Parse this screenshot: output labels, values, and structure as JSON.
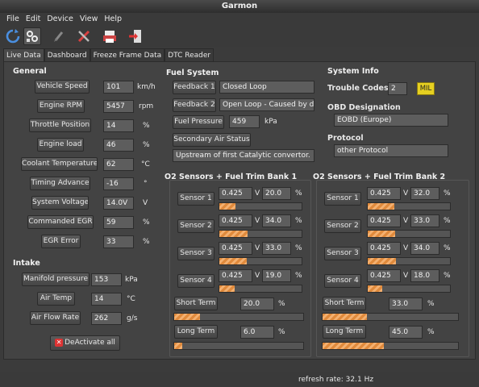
{
  "window": {
    "title": "Garmon"
  },
  "menu": [
    "File",
    "Edit",
    "Device",
    "View",
    "Help"
  ],
  "toolbar": {
    "icons": [
      "refresh-icon",
      "settings-icon",
      "clear-icon",
      "tools-icon",
      "print-icon",
      "exit-icon"
    ]
  },
  "tabs": [
    "Live Data",
    "Dashboard",
    "Freeze Frame Data",
    "DTC Reader"
  ],
  "general": {
    "title": "General",
    "rows": [
      {
        "label": "Vehicle Speed",
        "value": "101",
        "unit": "km/h"
      },
      {
        "label": "Engine RPM",
        "value": "5457",
        "unit": "rpm"
      },
      {
        "label": "Throttle Position",
        "value": "14",
        "unit": "%"
      },
      {
        "label": "Engine load",
        "value": "46",
        "unit": "%"
      },
      {
        "label": "Coolant Temperature",
        "value": "62",
        "unit": "°C"
      },
      {
        "label": "Timing Advance",
        "value": "-16",
        "unit": "°"
      },
      {
        "label": "System Voltage",
        "value": "14.0V",
        "unit": "V"
      },
      {
        "label": "Commanded EGR",
        "value": "59",
        "unit": "%"
      },
      {
        "label": "EGR Error",
        "value": "33",
        "unit": "%"
      }
    ]
  },
  "intake": {
    "title": "Intake",
    "rows": [
      {
        "label": "Manifold pressure",
        "value": "153",
        "unit": "kPa"
      },
      {
        "label": "Air Temp",
        "value": "14",
        "unit": "°C"
      },
      {
        "label": "Air Flow Rate",
        "value": "262",
        "unit": "g/s"
      }
    ]
  },
  "deactivate_label": "DeActivate all",
  "fuel": {
    "title": "Fuel System",
    "feedback1_label": "Feedback 1",
    "feedback1_value": "Closed Loop",
    "feedback2_label": "Feedback 2",
    "feedback2_value": "Open Loop - Caused by dri",
    "pressure_label": "Fuel Pressure",
    "pressure_value": "459",
    "pressure_unit": "kPa",
    "secondary_label": "Secondary Air Status",
    "secondary_value": "Upstream of first Catalytic convertor."
  },
  "system": {
    "title": "System Info",
    "trouble_label": "Trouble Codes",
    "trouble_value": "2",
    "mil_label": "MIL",
    "obd_label": "OBD Designation",
    "obd_value": "EOBD (Europe)",
    "protocol_label": "Protocol",
    "protocol_value": "other Protocol"
  },
  "bank1": {
    "title": "O2 Sensors + Fuel Trim Bank 1",
    "sensors": [
      {
        "label": "Sensor 1",
        "voltage": "0.425",
        "trim": "20.0",
        "level": 0.2
      },
      {
        "label": "Sensor 2",
        "voltage": "0.425",
        "trim": "34.0",
        "level": 0.34
      },
      {
        "label": "Sensor 3",
        "voltage": "0.425",
        "trim": "33.0",
        "level": 0.33
      },
      {
        "label": "Sensor 4",
        "voltage": "0.425",
        "trim": "19.0",
        "level": 0.19
      }
    ],
    "short_label": "Short Term",
    "short_value": "20.0",
    "short_level": 0.2,
    "long_label": "Long Term",
    "long_value": "6.0",
    "long_level": 0.06
  },
  "bank2": {
    "title": "O2 Sensors + Fuel Trim Bank 2",
    "sensors": [
      {
        "label": "Sensor 1",
        "voltage": "0.425",
        "trim": "32.0",
        "level": 0.32
      },
      {
        "label": "Sensor 2",
        "voltage": "0.425",
        "trim": "33.0",
        "level": 0.33
      },
      {
        "label": "Sensor 3",
        "voltage": "0.425",
        "trim": "34.0",
        "level": 0.34
      },
      {
        "label": "Sensor 4",
        "voltage": "0.425",
        "trim": "18.0",
        "level": 0.18
      }
    ],
    "short_label": "Short Term",
    "short_value": "33.0",
    "short_level": 0.33,
    "long_label": "Long Term",
    "long_value": "45.0",
    "long_level": 0.45
  },
  "units": {
    "volt": "V",
    "percent": "%"
  },
  "status": {
    "text": "refresh rate: 32.1 Hz"
  }
}
